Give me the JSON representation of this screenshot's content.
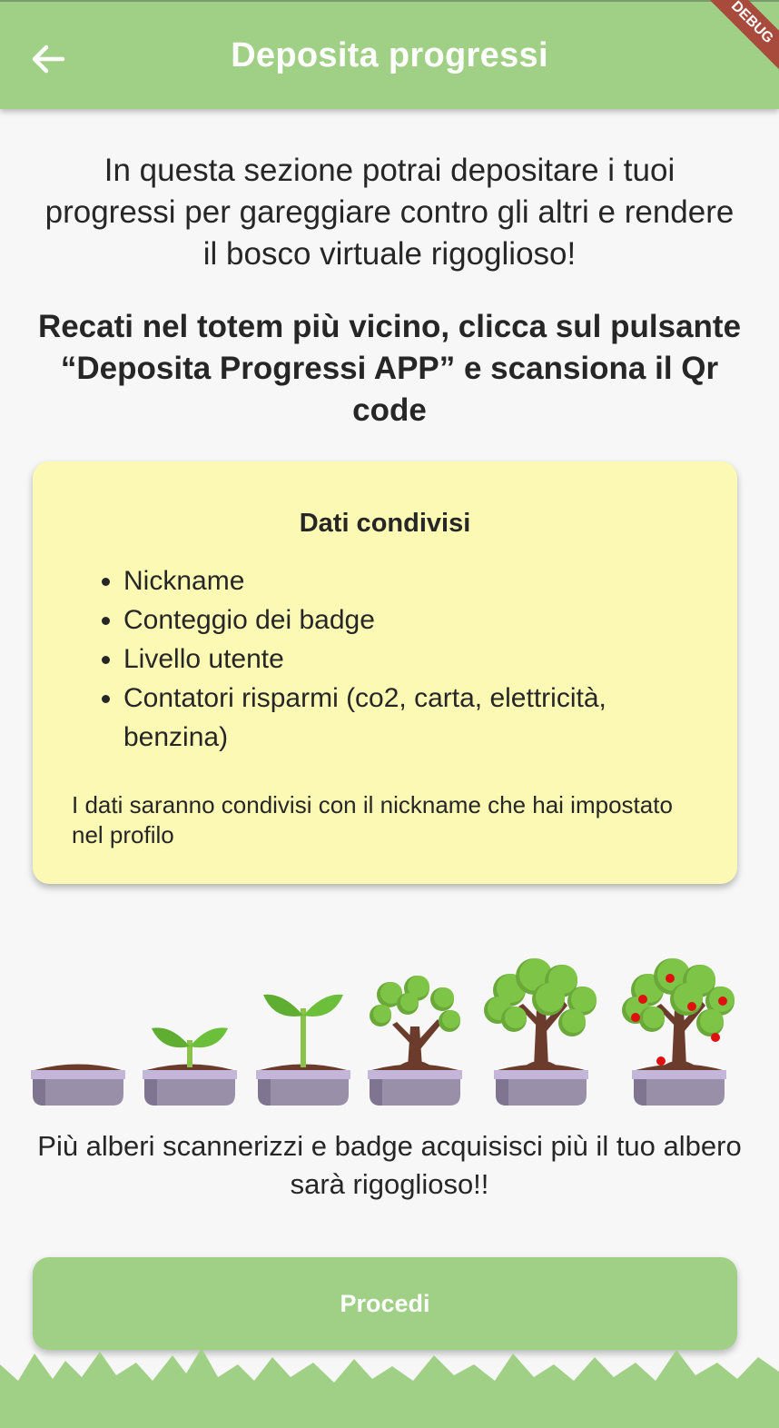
{
  "appbar": {
    "title": "Deposita progressi",
    "back_icon": "arrow-left-icon",
    "debug_banner": "DEBUG"
  },
  "intro": "In questa sezione potrai depositare i tuoi progressi per gareggiare contro gli altri e rendere il bosco virtuale rigoglioso!",
  "instruction": "Recati nel totem più vicino, clicca sul pulsante “Deposita Progressi APP” e scansiona il Qr code",
  "shared_data_card": {
    "title": "Dati condivisi",
    "items": [
      "Nickname",
      "Conteggio dei badge",
      "Livello utente",
      "Contatori risparmi (co2, carta, elettricità, benzina)"
    ],
    "note": "I dati saranno condivisi con il nickname che hai impostato nel profilo"
  },
  "tree_stages": [
    "soil-pot-icon",
    "small-sprout-icon",
    "tall-sprout-icon",
    "young-tree-icon",
    "leafy-tree-icon",
    "fruit-tree-icon"
  ],
  "growth_text": "Più alberi scannerizzi e badge acquisisci più il tuo albero sarà rigoglioso!!",
  "proceed_button": {
    "label": "Procedi"
  },
  "colors": {
    "primary_green": "#a0d085",
    "card_yellow": "#fcf9b5",
    "background": "#f6f7f6",
    "pot_purple": "#9a8fa8",
    "leaf_green": "#7dc447",
    "trunk_brown": "#6b3b2c",
    "fruit_red": "#e01010"
  }
}
